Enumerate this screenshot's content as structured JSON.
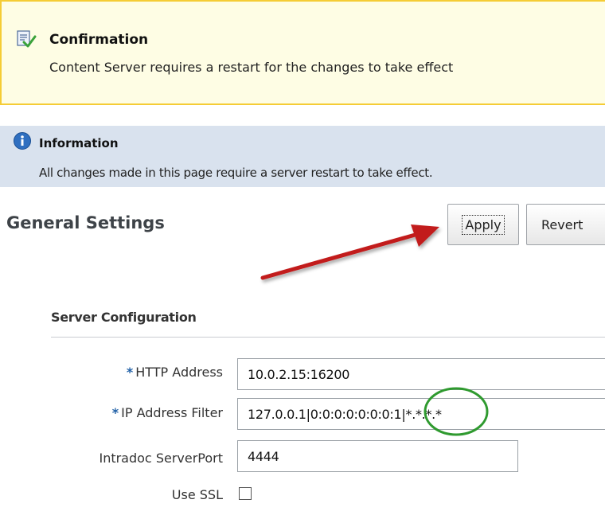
{
  "confirmation": {
    "icon": "document-check-icon",
    "title": "Confirmation",
    "message": "Content Server requires a restart for the changes to take effect",
    "border_color": "#f5cc35",
    "background_color": "#fefde4"
  },
  "information": {
    "icon": "info-icon",
    "title": "Information",
    "message": "All changes made in this page require a server restart to take effect.",
    "background_color": "#d9e2ee"
  },
  "header": {
    "title": "General Settings",
    "apply_label": "Apply",
    "revert_label": "Revert"
  },
  "section": {
    "title": "Server Configuration",
    "fields": [
      {
        "label": "HTTP Address",
        "required": "*",
        "value": "10.0.2.15:16200"
      },
      {
        "label": "IP Address Filter",
        "required": "*",
        "value": "127.0.0.1|0:0:0:0:0:0:0:1|*.*.*.*"
      },
      {
        "label": "Intradoc ServerPort",
        "value": "4444"
      },
      {
        "label": "Use SSL",
        "checked": false
      }
    ]
  },
  "annotations": {
    "arrow_color": "#c21b1b",
    "circle_color": "#2f9a2f"
  }
}
